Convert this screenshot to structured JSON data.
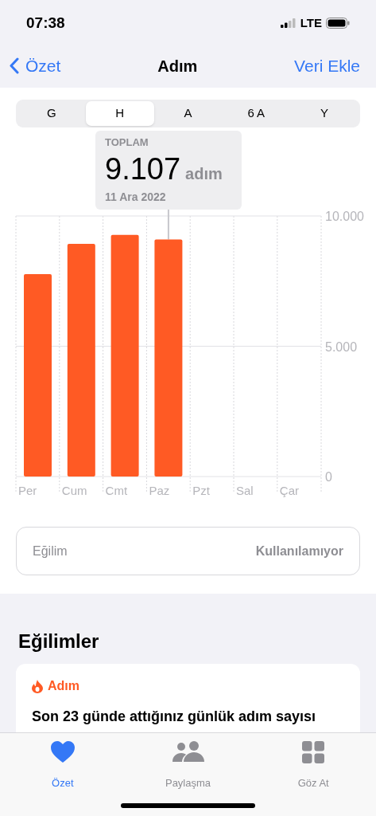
{
  "status_bar": {
    "time": "07:38",
    "network": "LTE"
  },
  "nav": {
    "back": "Özet",
    "title": "Adım",
    "action": "Veri Ekle"
  },
  "segments": [
    {
      "label": "G",
      "selected": false
    },
    {
      "label": "H",
      "selected": true
    },
    {
      "label": "A",
      "selected": false
    },
    {
      "label": "6 A",
      "selected": false
    },
    {
      "label": "Y",
      "selected": false
    }
  ],
  "tooltip": {
    "label": "TOPLAM",
    "value": "9.107",
    "unit": "adım",
    "date": "11 Ara 2022"
  },
  "chart_data": {
    "type": "bar",
    "categories": [
      "Per",
      "Cum",
      "Cmt",
      "Paz",
      "Pzt",
      "Sal",
      "Çar"
    ],
    "series": [
      {
        "color": "#ff5a24",
        "values": [
          7770,
          8930,
          9270,
          9100,
          null,
          null,
          null
        ]
      }
    ],
    "ylim": [
      0,
      10000
    ],
    "yticks": [
      {
        "value": 0,
        "label": "0"
      },
      {
        "value": 5000,
        "label": "5.000"
      },
      {
        "value": 10000,
        "label": "10.000"
      }
    ]
  },
  "trend_row": {
    "label": "Eğilim",
    "value": "Kullanılamıyor"
  },
  "trends": {
    "heading": "Eğilimler",
    "card": {
      "category": "Adım",
      "text": "Son 23 günde attığınız günlük adım sayısı"
    }
  },
  "tab_bar": [
    {
      "label": "Özet",
      "selected": true
    },
    {
      "label": "Paylaşma",
      "selected": false
    },
    {
      "label": "Göz At",
      "selected": false
    }
  ]
}
